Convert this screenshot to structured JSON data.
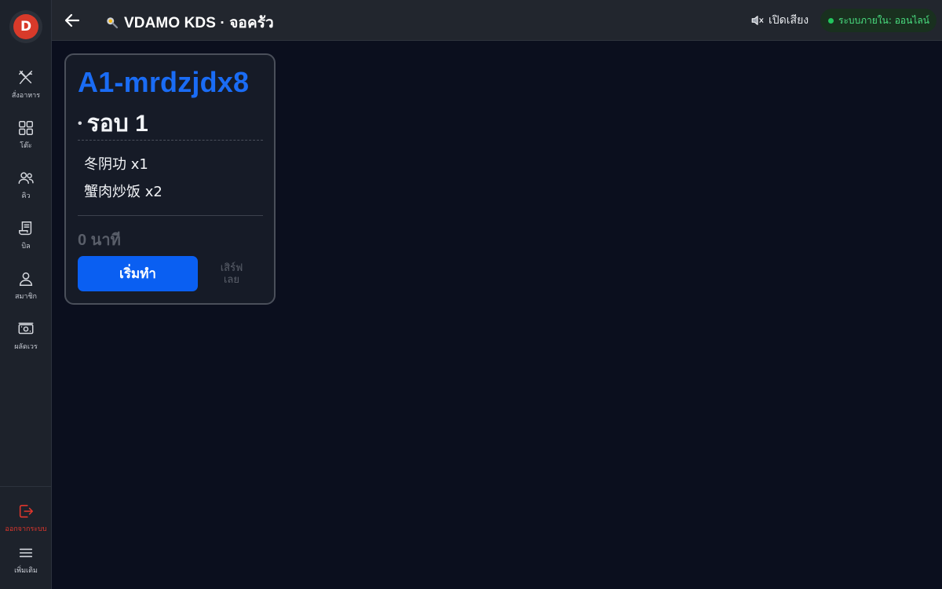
{
  "app": {
    "logo_letter": "D",
    "accent_color": "#0a5ff2",
    "id_color": "#1a6cf5",
    "online_color": "#22c55e",
    "logout_color": "#e0362c"
  },
  "sidebar": {
    "items": [
      {
        "label": "สั่งอาหาร",
        "icon": "utensils-icon"
      },
      {
        "label": "โต๊ะ",
        "icon": "grid-icon"
      },
      {
        "label": "คิว",
        "icon": "people-icon"
      },
      {
        "label": "บิล",
        "icon": "receipt-icon"
      },
      {
        "label": "สมาชิก",
        "icon": "user-icon"
      },
      {
        "label": "ผลัดเวร",
        "icon": "cash-icon"
      }
    ],
    "logout_label": "ออกจากระบบ",
    "more_label": "เพิ่มเติม"
  },
  "header": {
    "title_icon": "pan-icon",
    "title": "VDAMO KDS · จอครัว",
    "sound_label": "เปิดเสียง",
    "sound_icon": "speaker-muted-icon",
    "status_label": "ระบบภายใน: ออนไลน์"
  },
  "ticket": {
    "id": "A1-mrdzjdx8",
    "round": "รอบ 1",
    "items": [
      {
        "text": "冬阴功 x1"
      },
      {
        "text": "蟹肉炒饭 x2"
      }
    ],
    "elapsed": "0 นาที",
    "start_label": "เริ่มทำ",
    "serve_label": "เสิร์ฟ\nเลย"
  }
}
